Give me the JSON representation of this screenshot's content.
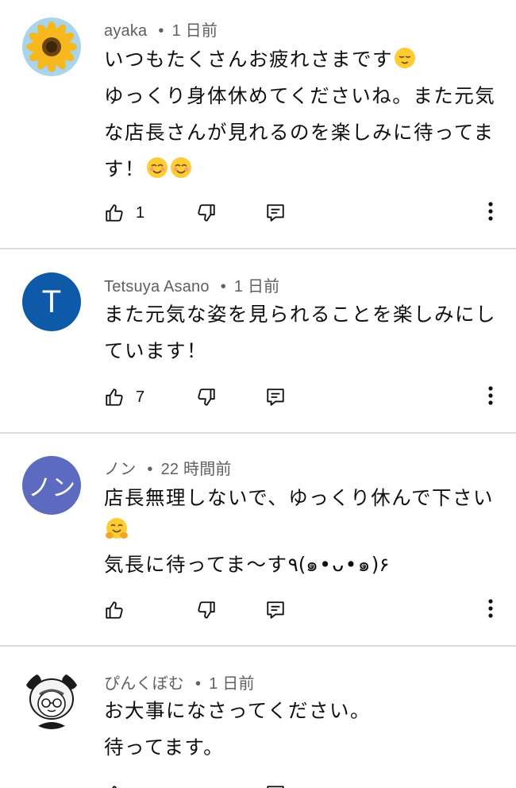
{
  "comments": [
    {
      "author": "ayaka",
      "time": "1 日前",
      "lines": [
        "いつもたくさんお疲れさまです",
        "ゆっくり身体休めてくださいね。また元気",
        "な店長さんが見れるのを楽しみに待ってま",
        "す！"
      ],
      "emojis": [
        "relieved-face",
        "smiling-face-with-smiling-eyes",
        "smiling-face-with-smiling-eyes"
      ],
      "likes": "1",
      "avatar_icon": "sunflower-avatar"
    },
    {
      "author": "Tetsuya Asano",
      "time": "1 日前",
      "lines": [
        "また元気な姿を見られることを楽しみにし",
        "ています！"
      ],
      "likes": "7",
      "avatar_letter": "T",
      "avatar_color": "#0f5aa8"
    },
    {
      "author": "ノン",
      "time": "22 時間前",
      "lines": [
        "店長無理しないで、ゆっくり休んで下さい",
        "",
        "気長に待ってま〜す٩(๑•ᴗ•๑)۶"
      ],
      "emojis": [
        "hugging-face"
      ],
      "likes": "",
      "avatar_letter": "ノン",
      "avatar_color": "#5c6bc0"
    },
    {
      "author": "ぴんくぼむ",
      "time": "1 日前",
      "lines": [
        "お大事になさってください。",
        "待ってます。"
      ],
      "avatar_icon": "panda-hood-avatar"
    }
  ],
  "icons": {
    "like": "thumbs-up-icon",
    "dislike": "thumbs-down-icon",
    "reply": "reply-icon",
    "more": "more-vert-icon"
  },
  "colors": {
    "meta_text": "#606060",
    "divider": "#dcdcdc",
    "emoji_yellow": "#ffcc33"
  }
}
